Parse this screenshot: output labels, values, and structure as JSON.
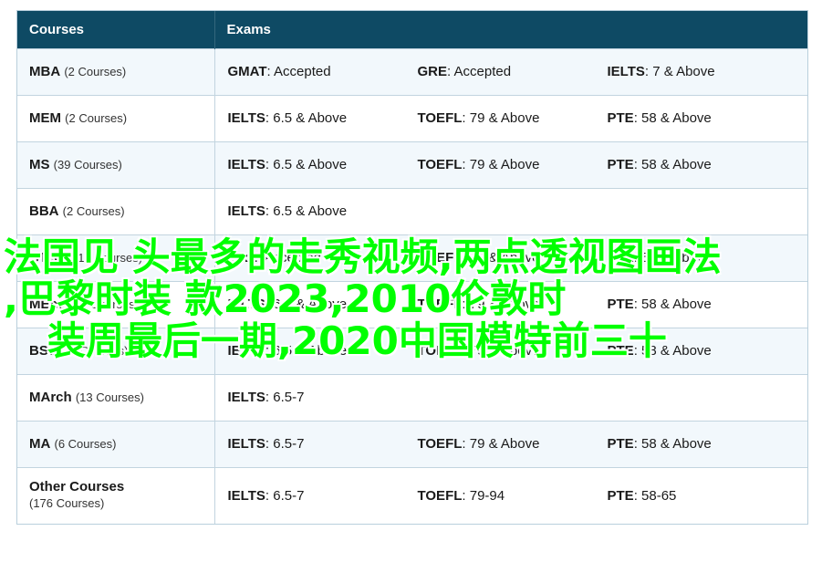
{
  "header": {
    "courses": "Courses",
    "exams": "Exams"
  },
  "rows": [
    {
      "name": "MBA",
      "count": "(2 Courses)",
      "exams": [
        {
          "n": "GMAT",
          "v": ": Accepted"
        },
        {
          "n": "GRE",
          "v": ": Accepted"
        },
        {
          "n": "IELTS",
          "v": ": 7 & Above"
        }
      ]
    },
    {
      "name": "MEM",
      "count": "(2 Courses)",
      "exams": [
        {
          "n": "IELTS",
          "v": ": 6.5 & Above"
        },
        {
          "n": "TOEFL",
          "v": ": 79 & Above"
        },
        {
          "n": "PTE",
          "v": ": 58 & Above"
        }
      ]
    },
    {
      "name": "MS",
      "count": "(39 Courses)",
      "exams": [
        {
          "n": "IELTS",
          "v": ": 6.5 & Above"
        },
        {
          "n": "TOEFL",
          "v": ": 79 & Above"
        },
        {
          "n": "PTE",
          "v": ": 58 & Above"
        }
      ]
    },
    {
      "name": "BBA",
      "count": "(2 Courses)",
      "exams": [
        {
          "n": "IELTS",
          "v": ": 6.5 & Above"
        }
      ]
    },
    {
      "name": "BTech",
      "count": "(17 Courses)",
      "exams": [
        {
          "n": "GRE",
          "v": ": Accepted"
        },
        {
          "n": "TOEFL",
          "v": ": 79 & Above"
        },
        {
          "n": "PTE",
          "v": ": 58 & Above"
        }
      ]
    },
    {
      "name": "MEng",
      "count": "(24 Courses)",
      "exams": [
        {
          "n": "IELTS",
          "v": ": 6.5 & Above"
        },
        {
          "n": "TOEFL",
          "v": ": 79 & Above"
        },
        {
          "n": "PTE",
          "v": ": 58 & Above"
        }
      ]
    },
    {
      "name": "BSc",
      "count": "(33 Courses)",
      "exams": [
        {
          "n": "IELTS",
          "v": ": 6.5 & Above"
        },
        {
          "n": "TOEFL",
          "v": ": 79 & Above"
        },
        {
          "n": "PTE",
          "v": ": 58 & Above"
        }
      ]
    },
    {
      "name": "MArch",
      "count": "(13 Courses)",
      "exams": [
        {
          "n": "IELTS",
          "v": ": 6.5-7"
        }
      ]
    },
    {
      "name": "MA",
      "count": "(6 Courses)",
      "exams": [
        {
          "n": "IELTS",
          "v": ": 6.5-7"
        },
        {
          "n": "TOEFL",
          "v": ": 79 & Above"
        },
        {
          "n": "PTE",
          "v": ": 58 & Above"
        }
      ]
    },
    {
      "name": "Other Courses",
      "count": "(176 Courses)",
      "exams": [
        {
          "n": "IELTS",
          "v": ": 6.5-7"
        },
        {
          "n": "TOEFL",
          "v": ": 79-94"
        },
        {
          "n": "PTE",
          "v": ": 58-65"
        }
      ]
    }
  ],
  "overlay": {
    "line1": "法国见 头最多的走秀视频,两点透视图画法",
    "line2": ",巴黎时装  款2023,2010伦敦时",
    "line3": "装周最后一期,2020中国模特前三十",
    "color": "#00ff00"
  }
}
